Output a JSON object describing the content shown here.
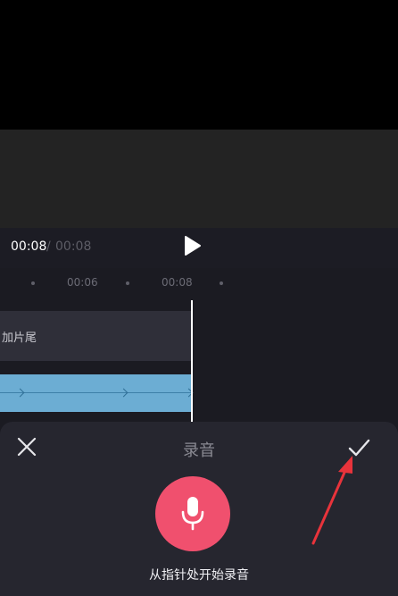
{
  "player": {
    "current_time": "00:08",
    "separator": "/",
    "total_time": "00:08",
    "play_icon": "play-icon"
  },
  "timeline": {
    "ruler_labels": [
      "00:06",
      "00:08"
    ],
    "clip_label": "加片尾"
  },
  "record_sheet": {
    "title": "录音",
    "close_icon": "close-icon",
    "confirm_icon": "check-icon",
    "mic_icon": "microphone-icon",
    "hint": "从指针处开始录音"
  },
  "colors": {
    "record_button": "#f0506e",
    "audio_track": "#6cadd3",
    "annotation_arrow": "#e8333b"
  }
}
